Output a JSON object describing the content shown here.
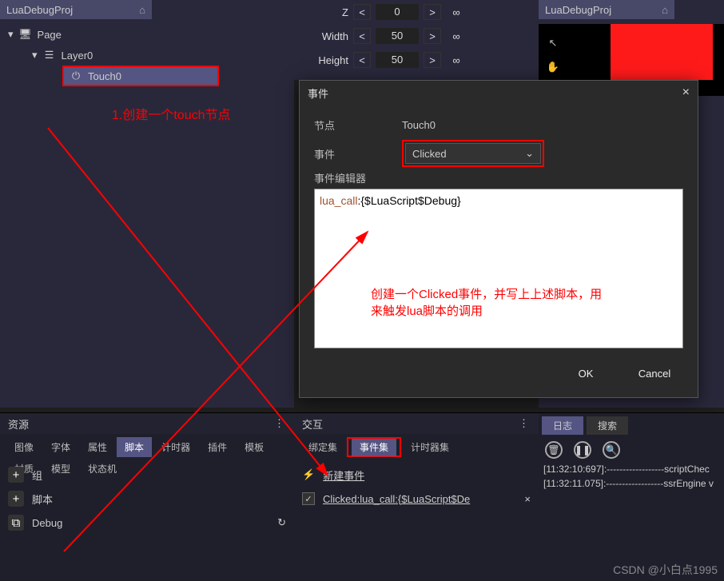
{
  "left": {
    "project": "LuaDebugProj",
    "tree": {
      "page": "Page",
      "layer": "Layer0",
      "touch": "Touch0"
    }
  },
  "mid_props": {
    "z": {
      "label": "Z",
      "value": "0"
    },
    "width": {
      "label": "Width",
      "value": "50"
    },
    "height": {
      "label": "Height",
      "value": "50"
    }
  },
  "right": {
    "project": "LuaDebugProj"
  },
  "dialog": {
    "title": "事件",
    "node_label": "节点",
    "node_value": "Touch0",
    "event_label": "事件",
    "event_value": "Clicked",
    "editor_label": "事件编辑器",
    "code_fn": "lua_call",
    "code_rest": ":{$LuaScript$Debug}",
    "ok": "OK",
    "cancel": "Cancel"
  },
  "resources": {
    "title": "资源",
    "tabs": [
      "图像",
      "字体",
      "属性",
      "脚本",
      "计时器",
      "插件",
      "模板",
      "材质",
      "模型",
      "状态机"
    ],
    "active": 3,
    "items": {
      "group": "组",
      "script": "脚本",
      "debug": "Debug"
    }
  },
  "interact": {
    "title": "交互",
    "tabs": [
      "绑定集",
      "事件集",
      "计时器集"
    ],
    "active": 1,
    "newevent": "新建事件",
    "entry": "Clicked:lua_call:{$LuaScript$De"
  },
  "log": {
    "tabs": [
      "日志",
      "搜索"
    ],
    "lines": [
      "[11:32:10:697]:------------------scriptChec",
      "[11:32:11.075]:------------------ssrEngine v"
    ]
  },
  "annotations": {
    "a1": "1.创建一个touch节点",
    "a2a": "创建一个Clicked事件，并写上上述脚本，用",
    "a2b": "来触发lua脚本的调用"
  },
  "watermark": "CSDN @小白点1995"
}
